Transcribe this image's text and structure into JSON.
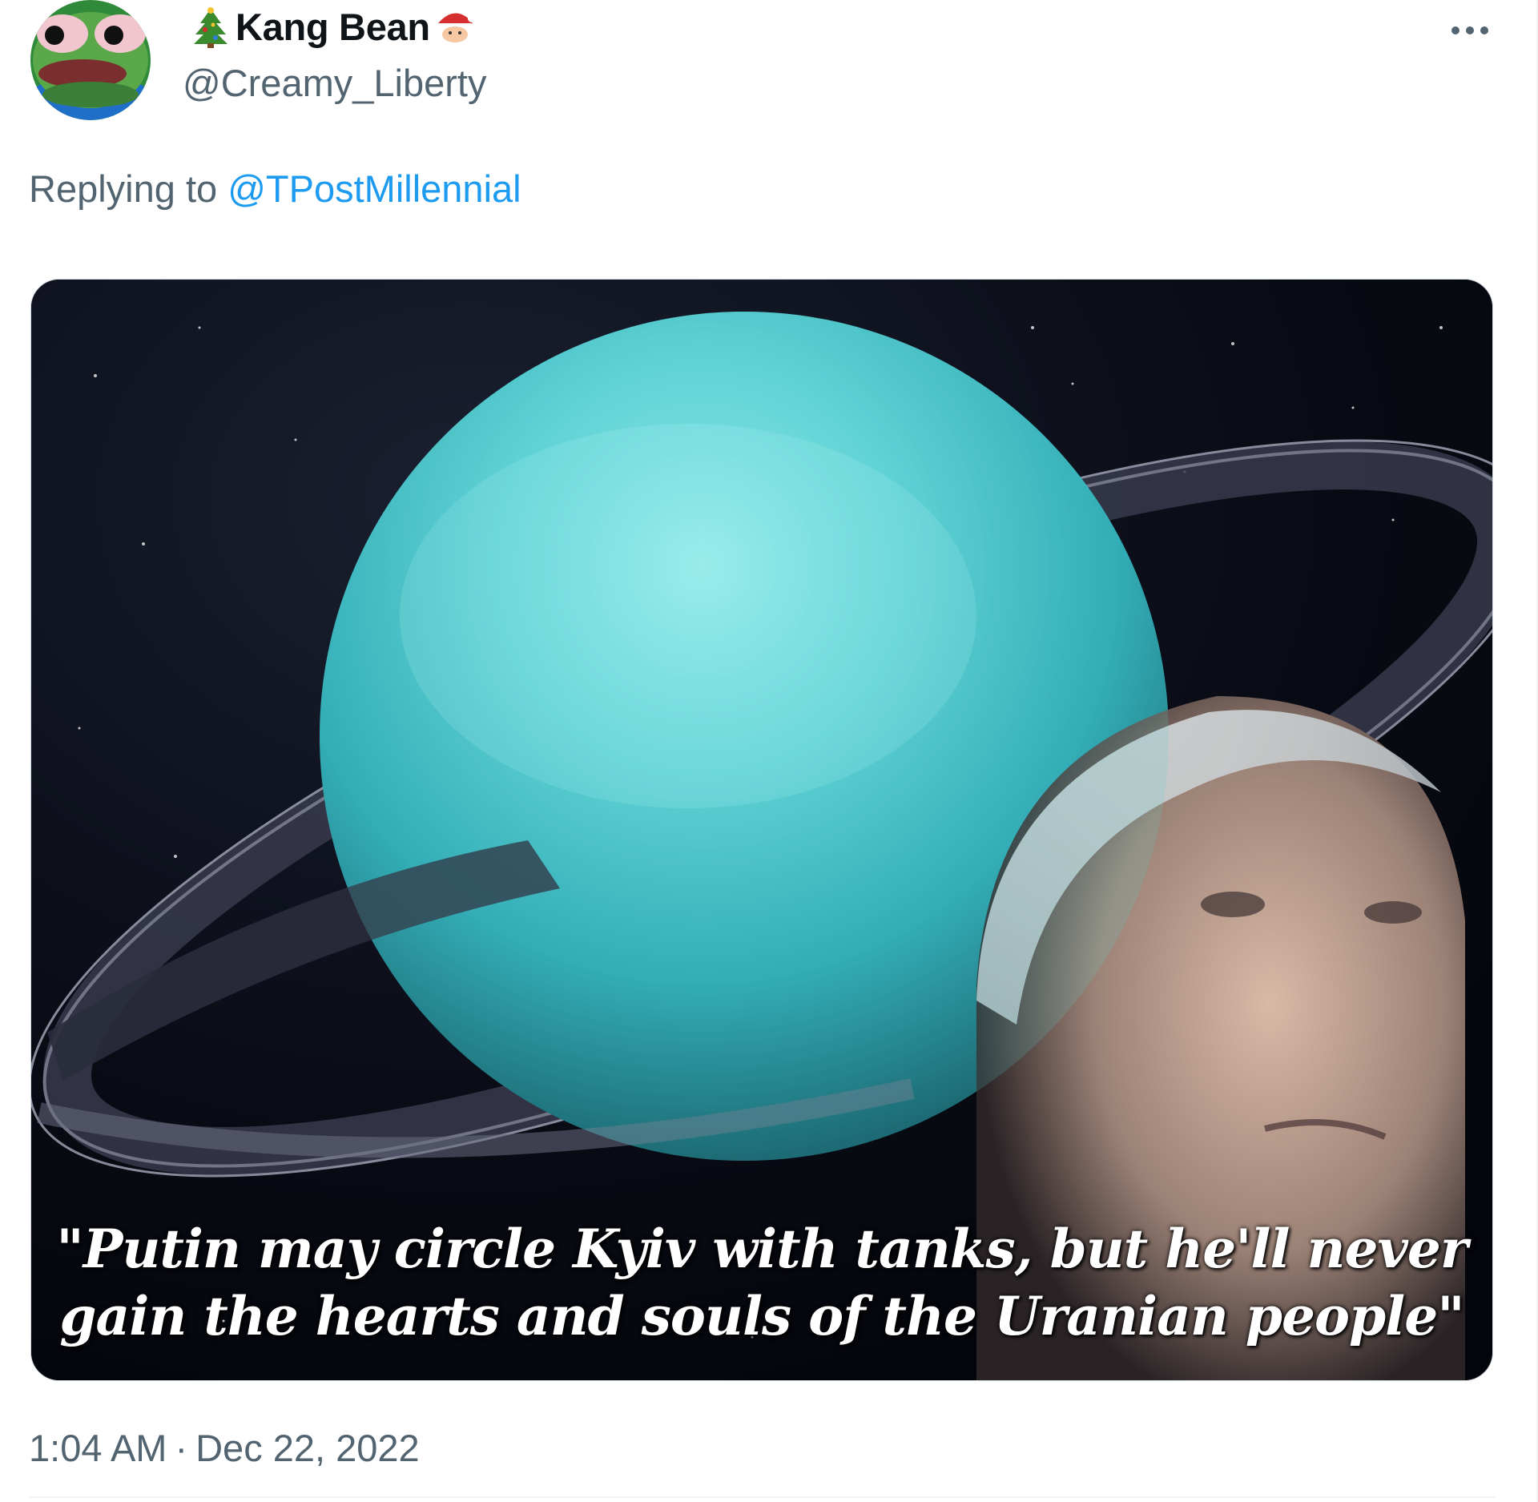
{
  "author": {
    "display_name": "Kang Bean",
    "handle": "@Creamy_Liberty",
    "name_prefix_emoji": "christmas-tree-icon",
    "name_suffix_emoji": "santa-claus-icon",
    "avatar_icon": "frog-avatar-icon"
  },
  "more_icon": "more-horizontal-icon",
  "reply": {
    "prefix": "Replying to",
    "mention": "@TPostMillennial"
  },
  "media": {
    "caption_line1": "\"Putin may circle Kyiv with tanks, but he'll never",
    "caption_line2": "gain the hearts and souls of the Uranian people\""
  },
  "meta": {
    "time": "1:04 AM",
    "separator": "·",
    "date": "Dec 22, 2022"
  },
  "colors": {
    "link": "#1d9bf0",
    "secondary_text": "#536471",
    "primary_text": "#0f1419"
  }
}
